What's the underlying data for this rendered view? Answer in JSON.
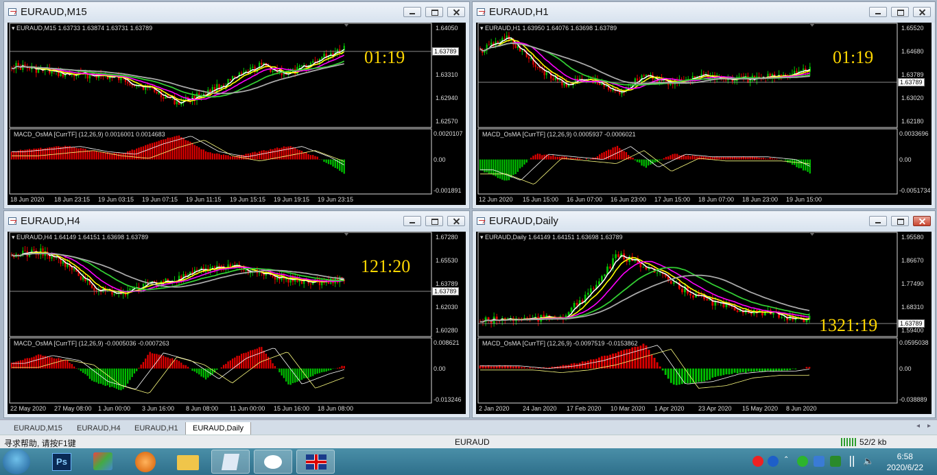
{
  "windows": [
    {
      "id": "m15",
      "title": "EURAUD,M15",
      "info": "EURAUD,M15  1.63733 1.63874 1.63731 1.63789",
      "counter": "01:19",
      "price_axis": [
        "1.64050",
        "1.63680",
        "1.63310",
        "1.62940",
        "1.62570"
      ],
      "price_tag": "1.63789",
      "macd_label": "MACD_OsMA [CurrTF] (12,26,9) 0.0016001 0.0014683",
      "macd_axis": [
        "0.0020107",
        "0.00",
        "-0.001891"
      ],
      "time_axis": [
        "18 Jun 2020",
        "18 Jun 23:15",
        "19 Jun 03:15",
        "19 Jun 07:15",
        "19 Jun 11:15",
        "19 Jun 15:15",
        "19 Jun 19:15",
        "19 Jun 23:15"
      ]
    },
    {
      "id": "h1",
      "title": "EURAUD,H1",
      "info": "EURAUD,H1  1.63950 1.64076 1.63698 1.63789",
      "counter": "01:19",
      "price_axis": [
        "1.65520",
        "1.64680",
        "1.63789",
        "1.63020",
        "1.62180"
      ],
      "price_tag": "1.63789",
      "macd_label": "MACD_OsMA [CurrTF] (12,26,9) 0.0005937 -0.0006021",
      "macd_axis": [
        "0.0033696",
        "0.00",
        "-0.0051734"
      ],
      "time_axis": [
        "12 Jun 2020",
        "15 Jun 15:00",
        "16 Jun 07:00",
        "16 Jun 23:00",
        "17 Jun 15:00",
        "18 Jun 07:00",
        "18 Jun 23:00",
        "19 Jun 15:00"
      ]
    },
    {
      "id": "h4",
      "title": "EURAUD,H4",
      "info": "EURAUD,H4  1.64149 1.64151 1.63698 1.63789",
      "counter": "121:20",
      "price_axis": [
        "1.67280",
        "1.65530",
        "1.63789",
        "1.62030",
        "1.60280"
      ],
      "price_tag": "1.63789",
      "macd_label": "MACD_OsMA [CurrTF] (12,26,9) -0.0005036 -0.0007263",
      "macd_axis": [
        "0.008621",
        "0.00",
        "-0.013246"
      ],
      "time_axis": [
        "22 May 2020",
        "27 May 08:00",
        "1 Jun 00:00",
        "3 Jun 16:00",
        "8 Jun 08:00",
        "11 Jun 00:00",
        "15 Jun 16:00",
        "18 Jun 08:00"
      ]
    },
    {
      "id": "d1",
      "title": "EURAUD,Daily",
      "info": "EURAUD,Daily  1.64149 1.64151 1.63698 1.63789",
      "counter": "1321:19",
      "price_axis": [
        "1.95580",
        "1.86670",
        "1.77490",
        "1.68310",
        "1.59400"
      ],
      "price_tag": "1.63789",
      "macd_label": "MACD_OsMA [CurrTF] (12,26,9) -0.0097519 -0.0153862",
      "macd_axis": [
        "0.0595038",
        "0.00",
        "-0.038889"
      ],
      "time_axis": [
        "2 Jan 2020",
        "24 Jan 2020",
        "17 Feb 2020",
        "10 Mar 2020",
        "1 Apr 2020",
        "23 Apr 2020",
        "15 May 2020",
        "8 Jun 2020"
      ]
    }
  ],
  "tabs": [
    "EURAUD,M15",
    "EURAUD,H4",
    "EURAUD,H1",
    "EURAUD,Daily"
  ],
  "active_tab": "EURAUD,Daily",
  "status": {
    "help": "寻求帮助, 请按F1键",
    "symbol": "EURAUD",
    "traffic": "52/2 kb"
  },
  "clock": {
    "time": "6:58",
    "date": "2020/6/22"
  },
  "taskbar": [
    "start-button",
    "photoshop-icon",
    "maps-icon",
    "app-icon",
    "folder-icon",
    "notes-icon",
    "wechat-icon",
    "flag-icon"
  ],
  "colors": {
    "bull": "#00c000",
    "bear": "#e00000",
    "ma_white": "#ffffff",
    "ma_yellow": "#ffff00",
    "ma_magenta": "#ff00ff",
    "ma_green": "#32cd32",
    "ma_gray": "#a9a9a9",
    "counter": "#ffd700"
  }
}
